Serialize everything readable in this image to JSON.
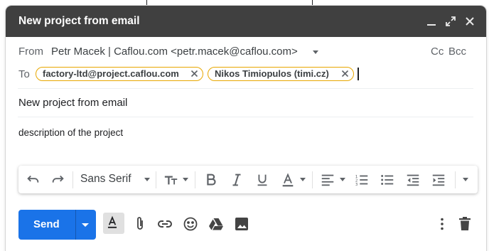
{
  "window": {
    "title": "New project from email"
  },
  "header": {
    "from_label": "From",
    "from_value": "Petr Macek | Caflou.com <petr.macek@caflou.com>",
    "cc_label": "Cc",
    "bcc_label": "Bcc",
    "to_label": "To",
    "recipients": [
      {
        "label": "factory-ltd@project.caflou.com"
      },
      {
        "label": "Nikos Timiopulos (timi.cz)"
      }
    ]
  },
  "compose": {
    "subject": "New project from email",
    "body": "description of the project"
  },
  "formatting": {
    "font": "Sans Serif"
  },
  "footer": {
    "send_label": "Send"
  },
  "colors": {
    "titlebar": "#404040",
    "send": "#1a73e8",
    "chip_border": "#e8a700"
  },
  "icons": [
    "minimize-icon",
    "expand-icon",
    "close-icon",
    "chevron-down-icon",
    "undo-icon",
    "redo-icon",
    "text-size-icon",
    "bold-icon",
    "italic-icon",
    "underline-icon",
    "text-color-icon",
    "align-icon",
    "numbered-list-icon",
    "bulleted-list-icon",
    "indent-less-icon",
    "indent-more-icon",
    "more-formatting-icon",
    "formatting-options-icon",
    "attach-icon",
    "link-icon",
    "emoji-icon",
    "drive-icon",
    "photo-icon",
    "more-options-icon",
    "trash-icon"
  ]
}
